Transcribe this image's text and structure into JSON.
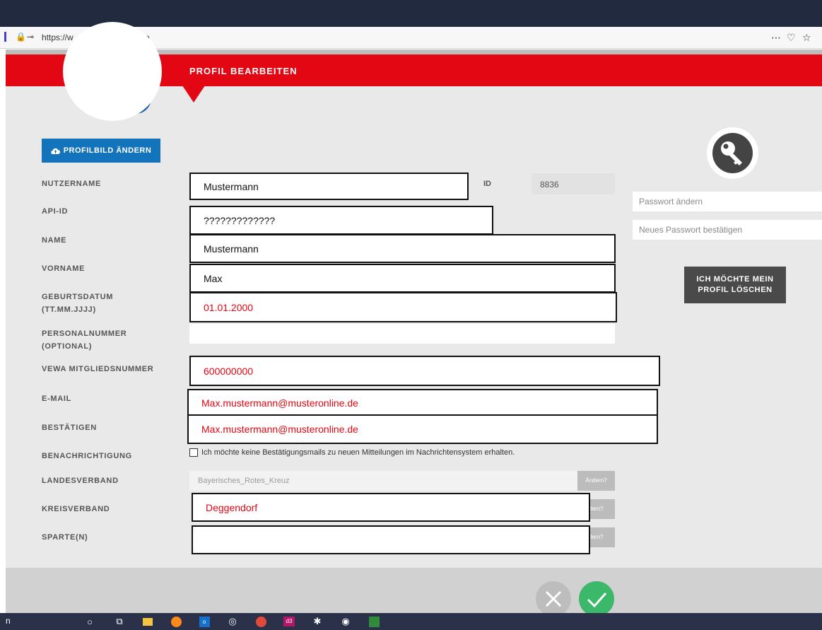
{
  "browser": {
    "url": "https://w",
    "url_tail": "e",
    "menu_icon": "more-dots-icon",
    "pocket_icon": "pocket-icon",
    "bookmark_icon": "star-icon"
  },
  "header": {
    "title": "PROFIL BEARBEITEN"
  },
  "profile_button": {
    "label": "PROFILBILD ÄNDERN",
    "icon": "cloud-upload-icon"
  },
  "labels": {
    "nutzername": "NUTZERNAME",
    "api_id": "API-ID",
    "name": "NAME",
    "vorname": "VORNAME",
    "geburtsdatum": "GEBURTSDATUM",
    "geburtsdatum_format": "(TT.MM.JJJJ)",
    "personalnummer": "PERSONALNUMMER",
    "personalnummer_opt": "(OPTIONAL)",
    "vewa": "VEWA MITGLIEDSNUMMER",
    "email": "E-MAIL",
    "bestaetigen": "BESTÄTIGEN",
    "benachrichtigung": "BENACHRICHTIGUNG",
    "landesverband": "LANDESVERBAND",
    "kreisverband": "KREISVERBAND",
    "sparten": "SPARTE(N)"
  },
  "values": {
    "nutzername": "Mustermann",
    "api_id": "?????????????",
    "name": "Mustermann",
    "vorname": "Max",
    "geburtsdatum": "01.01.2000",
    "personalnummer": "",
    "vewa": "600000000",
    "email": "Max.mustermann@musteronline.de",
    "bestaetigen": "Max.mustermann@musteronline.de",
    "landesverband": "Bayerisches_Rotes_Kreuz",
    "kreisverband": "Deggendorf",
    "sparten": ""
  },
  "id": {
    "label": "ID",
    "value": "8836"
  },
  "notification": {
    "text": "Ich möchte keine Bestätigungsmails zu neuen Mitteilungen im Nachrichtensystem erhalten.",
    "checked": false
  },
  "change_button": "Ändern?",
  "change_button_partial": "dern?",
  "password": {
    "new_placeholder": "Passwort ändern",
    "confirm_placeholder": "Neues Passwort bestätigen",
    "icon": "key-icon"
  },
  "delete_button": {
    "line1": "ICH MÖCHTE MEIN",
    "line2": "PROFIL LÖSCHEN"
  },
  "actions": {
    "cancel_icon": "close-icon",
    "confirm_icon": "check-icon"
  },
  "taskbar": {
    "left_text": "n",
    "icons": [
      "cortana-icon",
      "task-view-icon",
      "file-explorer-icon",
      "firefox-icon",
      "outlook-icon",
      "app-icon",
      "chrome-icon",
      "d3-icon",
      "network-icon",
      "app-icon",
      "app-icon"
    ]
  },
  "colors": {
    "brand_red": "#e30613",
    "primary_blue": "#1374bb",
    "confirm_green": "#3bb86a"
  }
}
